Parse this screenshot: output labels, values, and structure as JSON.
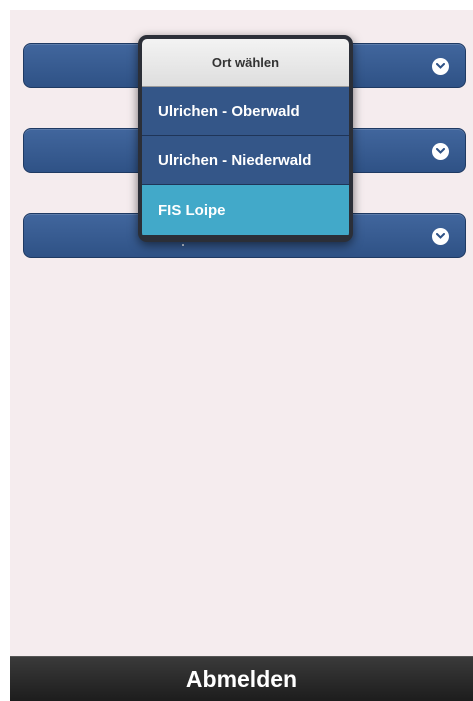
{
  "selects": [
    {
      "value": "",
      "icon": "chevron-down-icon"
    },
    {
      "value": "",
      "icon": "chevron-down-icon"
    },
    {
      "value": "",
      "icon": "chevron-down-icon"
    }
  ],
  "picker": {
    "title": "Ort wählen",
    "options": [
      "Ulrichen - Oberwald",
      "Ulrichen - Niederwald",
      "FIS Loipe"
    ],
    "selected_index": 2
  },
  "footer": {
    "logout_label": "Abmelden"
  },
  "colors": {
    "page_bg": "#f5ecee",
    "select_bg": "#3a5d94",
    "option_bg": "#345688",
    "option_selected_bg": "#42a9c9",
    "footer_bg": "#2a2a2a"
  }
}
